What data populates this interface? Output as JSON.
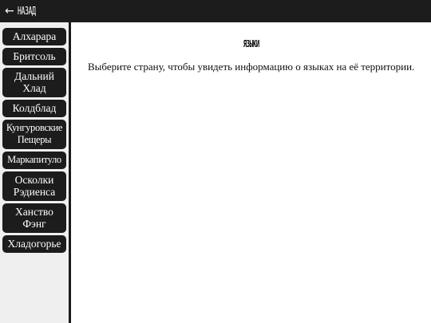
{
  "header": {
    "back_arrow": "←",
    "back_label": "НАЗАД"
  },
  "sidebar": {
    "countries": [
      "Алхарара",
      "Бритсоль",
      "Дальний\nХлад",
      "Колдблад",
      "Кунгуровские\nПещеры",
      "Маркапитуло",
      "Осколки\nРэдиенса",
      "Ханство\nФэнг",
      "Хладогорье"
    ]
  },
  "main": {
    "title": "ЯЗЫКИ",
    "description": "Выберите страну, чтобы увидеть информацию о языках на её территории."
  },
  "colors": {
    "topbar": "#1c1c1c",
    "sidebar_bg": "#efefef",
    "button_bg": "#1c1c1c",
    "button_text": "#ffffff"
  }
}
